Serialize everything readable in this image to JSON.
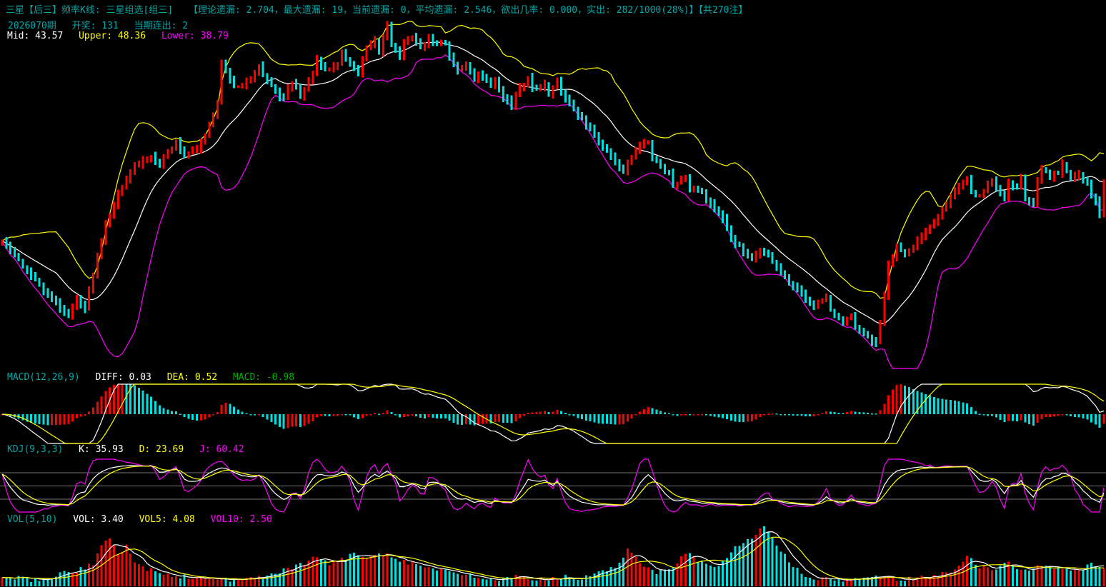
{
  "header": {
    "title": "三星【后三】频率K线: 三星组选[组三]",
    "stats": "【理论遗漏: 2.704，最大遗漏: 19，当前遗漏: 0，平均遗漏: 2.546，欲出几率: 0.000，实出: 282/1000(28%)】【共270注】",
    "period": "2026070期",
    "draw": "开奖: 131",
    "streak": "当期连出: 2",
    "boll_mid": "Mid: 43.57",
    "boll_upper": "Upper: 48.36",
    "boll_lower": "Lower: 38.79"
  },
  "macd_panel": {
    "name": "MACD(12,26,9)",
    "diff": "DIFF: 0.03",
    "dea": "DEA: 0.52",
    "macd": "MACD: -0.98"
  },
  "kdj_panel": {
    "name": "KDJ(9,3,3)",
    "k": "K: 35.93",
    "d": "D: 23.69",
    "j": "J: 60.42"
  },
  "vol_panel": {
    "name": "VOL(5,10)",
    "vol": "VOL: 3.40",
    "vol5": "VOL5: 4.08",
    "vol10": "VOL10: 2.50"
  },
  "colors": {
    "background": "#000000",
    "header_text": "#00a8a8",
    "up_candle": "#ff0000",
    "down_candle": "#00e0e0",
    "boll_upper": "#ffff00",
    "boll_mid": "#ffffff",
    "boll_lower": "#ff00ff",
    "diff_line": "#ffffff",
    "dea_line": "#ffff00",
    "k_line": "#ffffff",
    "d_line": "#ffff00",
    "j_line": "#ff00ff",
    "vol5_line": "#ffffff",
    "vol10_line": "#ffff00",
    "grid_line": "#787878",
    "macd_value_text": "#00b000"
  },
  "chart_data": {
    "type": "candlestick",
    "title": "三星组选[组三] 频率K线 (lottery frequency K-line with BOLL / MACD / KDJ / VOL panels)",
    "periods": 267,
    "seed": 42,
    "wiggle": 0.3,
    "range_jitter": 0.55,
    "main": {
      "ylim": [
        16.5,
        69.2
      ],
      "boll_window": 14,
      "boll_mult": 2.1,
      "last_values": {
        "mid": 43.57,
        "upper": 48.36,
        "lower": 38.79
      }
    },
    "close_keypoints": [
      [
        0,
        35.4
      ],
      [
        5,
        31.7
      ],
      [
        10,
        28.0
      ],
      [
        16,
        24.3
      ],
      [
        18,
        26.9
      ],
      [
        20,
        25.4
      ],
      [
        25,
        38.0
      ],
      [
        28,
        42.2
      ],
      [
        31,
        45.9
      ],
      [
        36,
        48.0
      ],
      [
        38,
        46.9
      ],
      [
        42,
        50.1
      ],
      [
        44,
        48.0
      ],
      [
        47,
        49.0
      ],
      [
        49,
        51.1
      ],
      [
        52,
        55.9
      ],
      [
        53,
        61.7
      ],
      [
        55,
        59.0
      ],
      [
        57,
        58.0
      ],
      [
        60,
        59.6
      ],
      [
        62,
        61.7
      ],
      [
        63,
        60.1
      ],
      [
        66,
        57.5
      ],
      [
        68,
        56.4
      ],
      [
        70,
        59.0
      ],
      [
        72,
        56.9
      ],
      [
        74,
        59.0
      ],
      [
        76,
        62.2
      ],
      [
        78,
        60.6
      ],
      [
        81,
        61.7
      ],
      [
        82,
        63.3
      ],
      [
        84,
        61.7
      ],
      [
        86,
        60.1
      ],
      [
        87,
        62.2
      ],
      [
        88,
        63.8
      ],
      [
        90,
        64.8
      ],
      [
        91,
        63.3
      ],
      [
        93,
        67.7
      ],
      [
        94,
        64.8
      ],
      [
        96,
        62.7
      ],
      [
        97,
        64.8
      ],
      [
        99,
        65.9
      ],
      [
        101,
        63.8
      ],
      [
        103,
        65.4
      ],
      [
        105,
        64.3
      ],
      [
        107,
        64.8
      ],
      [
        108,
        62.7
      ],
      [
        110,
        60.6
      ],
      [
        112,
        61.7
      ],
      [
        114,
        59.0
      ],
      [
        115,
        60.1
      ],
      [
        118,
        58.5
      ],
      [
        119,
        59.0
      ],
      [
        121,
        56.9
      ],
      [
        123,
        55.4
      ],
      [
        125,
        58.0
      ],
      [
        127,
        59.6
      ],
      [
        128,
        58.0
      ],
      [
        131,
        58.5
      ],
      [
        132,
        56.9
      ],
      [
        134,
        59.6
      ],
      [
        135,
        57.5
      ],
      [
        137,
        55.9
      ],
      [
        139,
        53.8
      ],
      [
        142,
        52.2
      ],
      [
        144,
        50.1
      ],
      [
        146,
        49.0
      ],
      [
        148,
        46.9
      ],
      [
        150,
        45.9
      ],
      [
        152,
        48.0
      ],
      [
        154,
        49.6
      ],
      [
        156,
        50.1
      ],
      [
        157,
        48.0
      ],
      [
        159,
        46.4
      ],
      [
        161,
        45.4
      ],
      [
        162,
        43.8
      ],
      [
        165,
        44.8
      ],
      [
        166,
        43.3
      ],
      [
        168,
        43.3
      ],
      [
        170,
        41.7
      ],
      [
        172,
        40.1
      ],
      [
        174,
        38.5
      ],
      [
        176,
        35.9
      ],
      [
        179,
        33.8
      ],
      [
        181,
        32.7
      ],
      [
        183,
        34.3
      ],
      [
        185,
        33.2
      ],
      [
        187,
        31.7
      ],
      [
        188,
        30.6
      ],
      [
        190,
        29.0
      ],
      [
        192,
        28.0
      ],
      [
        194,
        26.9
      ],
      [
        196,
        25.9
      ],
      [
        199,
        26.9
      ],
      [
        200,
        24.8
      ],
      [
        203,
        23.2
      ],
      [
        205,
        24.3
      ],
      [
        206,
        22.7
      ],
      [
        209,
        21.1
      ],
      [
        211,
        20.1
      ],
      [
        212,
        23.2
      ],
      [
        214,
        31.7
      ],
      [
        216,
        34.8
      ],
      [
        218,
        33.8
      ],
      [
        220,
        34.3
      ],
      [
        222,
        35.9
      ],
      [
        224,
        37.5
      ],
      [
        226,
        39.0
      ],
      [
        227,
        40.3
      ],
      [
        229,
        42.0
      ],
      [
        231,
        43.5
      ],
      [
        233,
        44.3
      ],
      [
        234,
        42.4
      ],
      [
        236,
        42.0
      ],
      [
        238,
        43.8
      ],
      [
        239,
        44.3
      ],
      [
        241,
        42.4
      ],
      [
        242,
        41.7
      ],
      [
        243,
        44.3
      ],
      [
        245,
        43.2
      ],
      [
        246,
        44.8
      ],
      [
        247,
        41.7
      ],
      [
        249,
        40.6
      ],
      [
        250,
        44.3
      ],
      [
        251,
        46.2
      ],
      [
        252,
        45.9
      ],
      [
        253,
        44.8
      ],
      [
        255,
        45.6
      ],
      [
        256,
        46.6
      ],
      [
        258,
        44.8
      ],
      [
        259,
        45.3
      ],
      [
        260,
        45.1
      ],
      [
        262,
        44.3
      ],
      [
        263,
        42.0
      ],
      [
        264,
        41.2
      ],
      [
        265,
        39.0
      ],
      [
        266,
        44.3
      ]
    ],
    "macd": {
      "fast": 12,
      "slow": 26,
      "signal": 9
    },
    "kdj": {
      "n": 9,
      "m1": 3,
      "m2": 3,
      "gridlines": [
        80,
        50,
        20
      ]
    },
    "vol": {
      "ma_fast": 5,
      "ma_slow": 10,
      "ylim": [
        0,
        8.2
      ]
    },
    "vol_keypoints": [
      [
        0,
        0.9
      ],
      [
        4,
        1.3
      ],
      [
        8,
        0.8
      ],
      [
        14,
        1.6
      ],
      [
        18,
        2.2
      ],
      [
        22,
        3.0
      ],
      [
        24,
        5.3
      ],
      [
        26,
        6.8
      ],
      [
        28,
        4.5
      ],
      [
        30,
        5.6
      ],
      [
        32,
        3.2
      ],
      [
        35,
        2.4
      ],
      [
        38,
        1.7
      ],
      [
        42,
        1.4
      ],
      [
        48,
        1.1
      ],
      [
        54,
        1.0
      ],
      [
        58,
        0.8
      ],
      [
        62,
        1.2
      ],
      [
        66,
        1.8
      ],
      [
        70,
        2.4
      ],
      [
        73,
        3.2
      ],
      [
        76,
        4.1
      ],
      [
        79,
        3.0
      ],
      [
        82,
        3.6
      ],
      [
        85,
        4.4
      ],
      [
        88,
        4.0
      ],
      [
        91,
        4.7
      ],
      [
        94,
        4.2
      ],
      [
        97,
        3.4
      ],
      [
        100,
        3.0
      ],
      [
        104,
        2.4
      ],
      [
        108,
        1.9
      ],
      [
        112,
        1.5
      ],
      [
        116,
        1.1
      ],
      [
        120,
        0.9
      ],
      [
        124,
        1.2
      ],
      [
        128,
        0.8
      ],
      [
        132,
        1.1
      ],
      [
        136,
        1.4
      ],
      [
        140,
        1.0
      ],
      [
        144,
        1.8
      ],
      [
        148,
        2.6
      ],
      [
        151,
        5.0
      ],
      [
        154,
        3.2
      ],
      [
        158,
        1.8
      ],
      [
        162,
        2.4
      ],
      [
        165,
        4.5
      ],
      [
        168,
        3.6
      ],
      [
        171,
        2.6
      ],
      [
        174,
        3.3
      ],
      [
        177,
        5.2
      ],
      [
        180,
        6.4
      ],
      [
        182,
        7.2
      ],
      [
        184,
        8.0
      ],
      [
        186,
        6.6
      ],
      [
        188,
        5.0
      ],
      [
        190,
        3.4
      ],
      [
        193,
        1.6
      ],
      [
        197,
        1.0
      ],
      [
        202,
        0.8
      ],
      [
        207,
        1.1
      ],
      [
        212,
        1.4
      ],
      [
        217,
        0.9
      ],
      [
        222,
        1.3
      ],
      [
        226,
        1.6
      ],
      [
        230,
        2.2
      ],
      [
        233,
        3.9
      ],
      [
        236,
        2.8
      ],
      [
        239,
        2.2
      ],
      [
        242,
        3.4
      ],
      [
        245,
        2.6
      ],
      [
        248,
        2.0
      ],
      [
        251,
        2.8
      ],
      [
        254,
        2.2
      ],
      [
        257,
        2.6
      ],
      [
        260,
        2.1
      ],
      [
        263,
        2.9
      ],
      [
        265,
        2.3
      ],
      [
        266,
        2.6
      ]
    ]
  }
}
